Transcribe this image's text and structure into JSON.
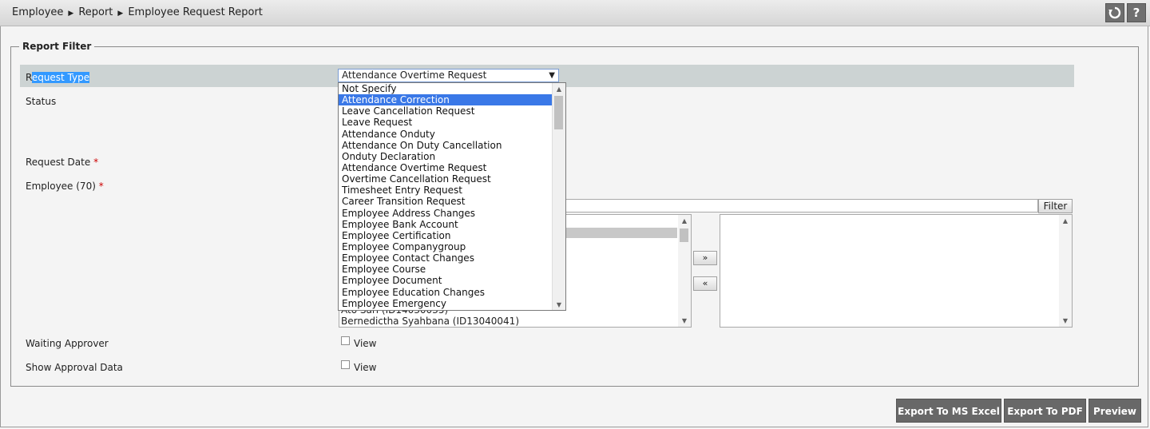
{
  "breadcrumb": [
    "Employee",
    "Report",
    "Employee Request Report"
  ],
  "toolbar": {
    "refresh_icon": "refresh-icon",
    "help_label": "?"
  },
  "legend": "Report Filter",
  "labels": {
    "request_type_prefix": "R",
    "request_type_selected": "equest Type",
    "status": "Status",
    "request_date": "Request Date",
    "employee": "Employee (70)",
    "required_mark": "*",
    "waiting_approver": "Waiting Approver",
    "show_approval": "Show Approval Data"
  },
  "request_type": {
    "value": "Attendance Overtime Request",
    "options": [
      "Not Specify",
      "Attendance Correction",
      "Leave Cancellation Request",
      "Leave Request",
      "Attendance Onduty",
      "Attendance On Duty Cancellation",
      "Onduty Declaration",
      "Attendance Overtime Request",
      "Overtime Cancellation Request",
      "Timesheet Entry Request",
      "Career Transition Request",
      "Employee Address Changes",
      "Employee Bank Account",
      "Employee Certification",
      "Employee Companygroup",
      "Employee Contact Changes",
      "Employee Course",
      "Employee Document",
      "Employee Education Changes",
      "Employee Emergency"
    ],
    "highlighted": "Attendance Correction"
  },
  "employee_list": {
    "partial_item": "Ato Sari (ID14030035)",
    "last_item": "Bernedictha Syahbana (ID13040041)"
  },
  "filter_button": "Filter",
  "move_right": "»",
  "move_left": "«",
  "checkbox_label": "View",
  "buttons": {
    "excel": "Export To MS Excel",
    "pdf": "Export To PDF",
    "preview": "Preview"
  }
}
